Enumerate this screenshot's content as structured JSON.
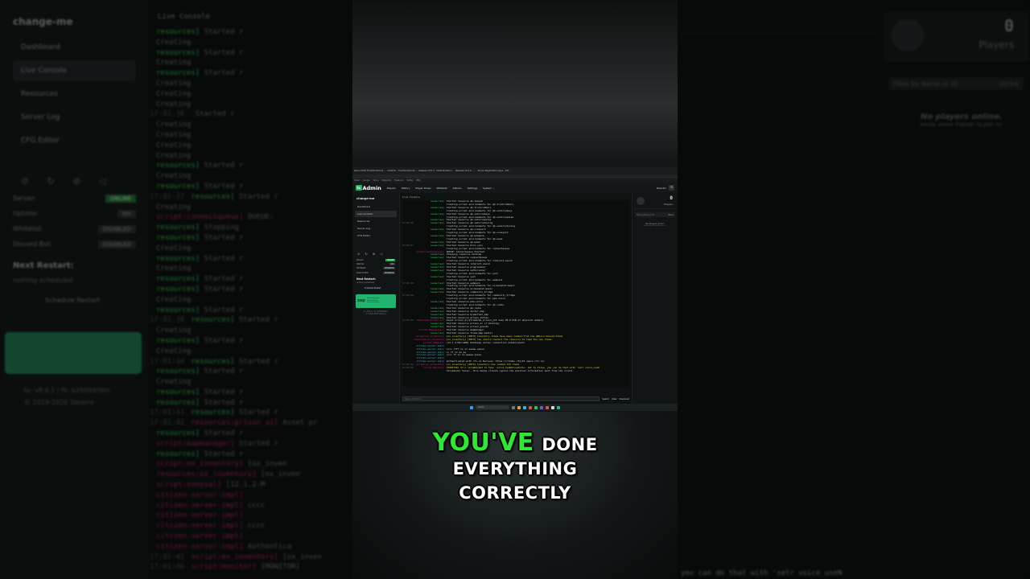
{
  "background": {
    "sidebar": {
      "brand": "change-me",
      "nav": [
        "Dashboard",
        "Live Console",
        "Resources",
        "Server Log",
        "CFG Editor"
      ],
      "status": [
        {
          "label": "Server:",
          "value": "ONLINE"
        },
        {
          "label": "Uptime:",
          "value": "0m"
        },
        {
          "label": "Whitelist:",
          "value": "DISABLED"
        },
        {
          "label": "Discord Bot:",
          "value": "DISABLED"
        }
      ],
      "restart_title": "Next Restart:",
      "restart_value": "nothing scheduled",
      "schedule_label": "Schedule Restart",
      "version_line1": "tx: v8.0.1 | fx: b25099/Win",
      "version_line2": "© 2019-2026 Tabarra"
    },
    "console_title": "Live Console",
    "console_lines": [
      {
        "time": "",
        "src": "resources]",
        "msg": "Started r"
      },
      {
        "time": "",
        "src": "",
        "msg": "Creating"
      },
      {
        "time": "",
        "src": "resources]",
        "msg": "Started r"
      },
      {
        "time": "",
        "src": "",
        "msg": "Creating"
      },
      {
        "time": "",
        "src": "resources]",
        "msg": "Started r"
      },
      {
        "time": "",
        "src": "",
        "msg": "Creating"
      },
      {
        "time": "",
        "src": "",
        "msg": "Creating"
      },
      {
        "time": "",
        "src": "",
        "msg": "Creating"
      },
      {
        "time": "17:01:36",
        "src": "",
        "msg": "Started r"
      },
      {
        "time": "",
        "src": "",
        "msg": "Creating"
      },
      {
        "time": "",
        "src": "",
        "msg": "Creating"
      },
      {
        "time": "",
        "src": "",
        "msg": "Creating"
      },
      {
        "time": "",
        "src": "",
        "msg": "Creating"
      },
      {
        "time": "",
        "src": "resources]",
        "msg": "Started r"
      },
      {
        "time": "",
        "src": "",
        "msg": "Creating"
      },
      {
        "time": "",
        "src": "resources]",
        "msg": "Started r"
      },
      {
        "time": "17:01:37",
        "src": "resources]",
        "msg": "Started r"
      },
      {
        "time": "",
        "src": "",
        "msg": "Creating"
      },
      {
        "time": "",
        "src": "script:connectqueue]",
        "msg": "QUEUE:"
      },
      {
        "time": "",
        "src": "resources]",
        "msg": "Stopping"
      },
      {
        "time": "",
        "src": "resources]",
        "msg": "Started r"
      },
      {
        "time": "",
        "src": "",
        "msg": "Creating"
      },
      {
        "time": "",
        "src": "resources]",
        "msg": "Started r"
      },
      {
        "time": "",
        "src": "",
        "msg": "Creating"
      },
      {
        "time": "",
        "src": "resources]",
        "msg": "Started r"
      },
      {
        "time": "",
        "src": "resources]",
        "msg": "Started r"
      },
      {
        "time": "",
        "src": "",
        "msg": "Creating"
      },
      {
        "time": "",
        "src": "resources]",
        "msg": "Started r"
      },
      {
        "time": "17:01:38",
        "src": "resources]",
        "msg": "Started r"
      },
      {
        "time": "",
        "src": "",
        "msg": "Creating"
      },
      {
        "time": "",
        "src": "resources]",
        "msg": "Started r"
      },
      {
        "time": "",
        "src": "",
        "msg": "Creating"
      },
      {
        "time": "17:01:40",
        "src": "resources]",
        "msg": "Started r"
      },
      {
        "time": "",
        "src": "resources]",
        "msg": "Started r"
      },
      {
        "time": "",
        "src": "",
        "msg": "Creating"
      },
      {
        "time": "",
        "src": "resources]",
        "msg": "Started r"
      },
      {
        "time": "",
        "src": "resources]",
        "msg": "Started r"
      },
      {
        "time": "17:01:41",
        "src": "resources]",
        "msg": "Started r"
      },
      {
        "time": "17:01:42",
        "src": "resources:prison_ai]",
        "msg": "Asset pr"
      },
      {
        "time": "",
        "src": "resources]",
        "msg": "Started r"
      },
      {
        "time": "",
        "src": "script:mapmanager]",
        "msg": "Started r"
      },
      {
        "time": "",
        "src": "resources]",
        "msg": "Started r"
      },
      {
        "time": "",
        "src": "script:ox_inventory]",
        "msg": "[ox_inven"
      },
      {
        "time": "",
        "src": "resources:ox_inventory]",
        "msg": "[ox_inven"
      },
      {
        "time": "",
        "src": "script:oxmysql]",
        "msg": "[12.1.2-M"
      },
      {
        "time": "",
        "src": "citizen-server-impl]",
        "msg": ""
      },
      {
        "time": "",
        "src": "citizen-server-impl]",
        "msg": "cccc"
      },
      {
        "time": "",
        "src": "citizen-server-impl]",
        "msg": ""
      },
      {
        "time": "",
        "src": "citizen-server-impl]",
        "msg": "cccc"
      },
      {
        "time": "",
        "src": "citizen-server-impl]",
        "msg": ""
      },
      {
        "time": "",
        "src": "citizen-server-impl]",
        "msg": "Authentica"
      },
      {
        "time": "17:01:42",
        "src": "script:ox_inventory]",
        "msg": "[ox_inven"
      },
      {
        "time": "17:01:46",
        "src": "script:monitor]",
        "msg": "[MONITOR]"
      }
    ],
    "players_count": "0",
    "players_label": "Players",
    "filter_placeholder": "Filter by Name or ID",
    "filter_shortcut": "ctrl+k",
    "no_players_title": "No players online.",
    "no_players_sub": "Invite some friends to join in!",
    "bottom_snippet": "you can do that with 'setr voice_useN"
  },
  "browser": {
    "tabs": [
      "Issue CSGO TheOnlineSocia...",
      "txAdmin - TheOnlineSocia...",
      "Release v0.0.3 - TheOnlineSoci...",
      "Release v2.0.0 - ...",
      "Server Registration Keys - Cfx..."
    ],
    "bookmarks": [
      "Gmail",
      "Google",
      "Yahoo",
      "Wikipedia",
      "Facebook",
      "Twitter",
      "BBC"
    ]
  },
  "app": {
    "logo_badge": "tx",
    "logo_text": "Admin",
    "menu": [
      "Players",
      "History",
      "Player Drops",
      "Whitelist",
      "Admins",
      "Settings",
      "System ⌄"
    ],
    "user": "Director",
    "sidebar": {
      "brand": "change-me",
      "nav": [
        "Dashboard",
        "Live Console",
        "Resources",
        "Server Log",
        "CFG Editor"
      ],
      "status": [
        {
          "label": "Server:",
          "value": "ONLINE"
        },
        {
          "label": "Uptime:",
          "value": "0m"
        },
        {
          "label": "Whitelist:",
          "value": "DISABLED"
        },
        {
          "label": "Discord Bot:",
          "value": "DISABLED"
        }
      ],
      "restart_title": "Next Restart:",
      "restart_value": "nothing scheduled",
      "schedule_label": "Schedule Restart",
      "ad_logo": "zap",
      "ad_line1": "Recommended",
      "ad_line2": "official FiveM",
      "ad_line3": "server provider",
      "version_line1": "tx: v8.0.1 | fx: b25099/Win",
      "version_line2": "© 2019-2026 Tabarra"
    },
    "console": {
      "title": "Live Console",
      "lines": [
        {
          "time": "",
          "src": "resources]",
          "msg": "Started resource qb-towjob"
        },
        {
          "time": "",
          "src": "",
          "msg": "Creating script environments for qb-truckrobbery"
        },
        {
          "time": "",
          "src": "resources]",
          "msg": "Started resource qb-truckrobbery"
        },
        {
          "time": "",
          "src": "",
          "msg": "Creating script environments for qb-vehiclekeys"
        },
        {
          "time": "",
          "src": "resources]",
          "msg": "Started resource qb-vehiclekeys"
        },
        {
          "time": "",
          "src": "",
          "msg": "Creating script environments for qb-vehiclesales"
        },
        {
          "time": "",
          "src": "resources]",
          "msg": "Started resource qb-vehiclesales"
        },
        {
          "time": "17:01:36",
          "src": "resources]",
          "msg": "Started resource qb-vehicletuning"
        },
        {
          "time": "",
          "src": "",
          "msg": "Creating script environments for qb-vehicletuning"
        },
        {
          "time": "",
          "src": "resources]",
          "msg": "Started resource qb-vineyard"
        },
        {
          "time": "",
          "src": "",
          "msg": "Creating script environments for qb-vineyard"
        },
        {
          "time": "",
          "src": "resources]",
          "msg": "Started resource qb-weapons"
        },
        {
          "time": "",
          "src": "",
          "msg": "Creating script environments for qb-weed"
        },
        {
          "time": "",
          "src": "resources]",
          "msg": "Started resource qb-weed"
        },
        {
          "time": "17:01:37",
          "src": "resources]",
          "msg": "Started resource bnrs-jail"
        },
        {
          "time": "",
          "src": "",
          "msg": "Creating script environments for connectqueue"
        },
        {
          "time": "",
          "src": "script:connectqueue]",
          "msg": "QUEUE: Connectqueue Started"
        },
        {
          "time": "",
          "src": "resources]",
          "msg": "Stopping resource hardcap"
        },
        {
          "time": "",
          "src": "resources]",
          "msg": "Started resource connectqueue"
        },
        {
          "time": "",
          "src": "",
          "msg": "Creating script environments for interact-sound"
        },
        {
          "time": "",
          "src": "resources]",
          "msg": "Started resource interact-sound"
        },
        {
          "time": "",
          "src": "resources]",
          "msg": "Started resource progressbar"
        },
        {
          "time": "",
          "src": "resources]",
          "msg": "Started resource safecracker"
        },
        {
          "time": "",
          "src": "",
          "msg": "Creating script environments for yarn"
        },
        {
          "time": "",
          "src": "resources]",
          "msg": "Started resource yarn"
        },
        {
          "time": "",
          "src": "",
          "msg": "Creating script environments for webpack"
        },
        {
          "time": "17:01:38",
          "src": "resources]",
          "msg": "Started resource webpack"
        },
        {
          "time": "",
          "src": "",
          "msg": "Creating script environments for screenshot-basic"
        },
        {
          "time": "",
          "src": "resources]",
          "msg": "Started resource screenshot-basic"
        },
        {
          "time": "",
          "src": "resources]",
          "msg": "Started resource community_bridge"
        },
        {
          "time": "17:01:40",
          "src": "",
          "msg": "Creating script environments for community_bridge"
        },
        {
          "time": "",
          "src": "",
          "msg": "Creating script environments for pma-voice"
        },
        {
          "time": "",
          "src": "resources]",
          "msg": "Started resource pma-voice"
        },
        {
          "time": "",
          "src": "",
          "msg": "Creating script environments for qb-radio"
        },
        {
          "time": "",
          "src": "resources]",
          "msg": "Started resource qb-radio"
        },
        {
          "time": "",
          "src": "resources]",
          "msg": "Started resource doctor_map"
        },
        {
          "time": "",
          "src": "resources]",
          "msg": "Started resource breakfast_map"
        },
        {
          "time": "",
          "src": "resources]",
          "msg": "Started resource prison_tattoo"
        },
        {
          "time": "17:01:41",
          "src": "resources:prison_ai]",
          "msg": "Asset prison_ai/stream/ap_prison_ytd uses 96.0 MiB of physical memory."
        },
        {
          "time": "",
          "src": "resources]",
          "msg": "Started resource prison_ai (1 warning)"
        },
        {
          "time": "",
          "src": "resources]",
          "msg": "Started resource prison_guards"
        },
        {
          "time": "",
          "src": "script:mapmanager]",
          "msg": "Started resource mapmanager"
        },
        {
          "time": "",
          "src": "resources]",
          "msg": "Started resource fivem-map-skater"
        },
        {
          "time": "",
          "src": "script:ox_inventory]",
          "msg": "[ox_inventory] [INFO] Inventory items have been loaded from the QBCore.Shared.Items"
        },
        {
          "time": "",
          "src": "resources:ox_inventory]",
          "msg": "[ox_inventory] [INFO] You should restart the resource to load the new items."
        },
        {
          "time": "",
          "src": "script:oxmysql]",
          "msg": "[12.1.2-MariaDB] Database server connection established!"
        },
        {
          "time": "",
          "src": "citizen-server-impl]",
          "msg": ""
        },
        {
          "time": "",
          "src": "citizen-server-impl]",
          "msg": "cccc  ffff  xx  xx  eeeee  sssss"
        },
        {
          "time": "",
          "src": "citizen-server-impl]",
          "msg": "cc    ff     xx    ee     ss"
        },
        {
          "time": "",
          "src": "citizen-server-impl]",
          "msg": "cccc  ff    xx  xx  eeeee  sssss"
        },
        {
          "time": "",
          "src": "citizen-server-impl]",
          "msg": ""
        },
        {
          "time": "",
          "src": "citizen-server-impl]",
          "msg": "Authenticated with cfx.re Nucleus: https://cfxdev-rfkjbf.users.cfx.re/"
        },
        {
          "time": "17:01:42",
          "src": "script:ox_inventory]",
          "msg": "[ox_inventory] [INFO] Inventory has loaded 312 items"
        },
        {
          "time": "17:01:46",
          "src": "script:monitor]",
          "msg": "[MONITOR] It's recommended to have 'voice_useNativeAudio' set to false, you can do that with 'setr voice_useN"
        },
        {
          "time": "",
          "src": "",
          "msg": "ativeAudio false', this means clients ignore the position information sent from the client."
        }
      ],
      "input_placeholder": "Type a command...",
      "buttons": [
        "Search",
        "Clear",
        "Download"
      ]
    },
    "players": {
      "count": "0",
      "label": "Players",
      "filter_placeholder": "Filter by Name or ID",
      "filter_shortcut": "ctrl+k",
      "none_title": "No players online.",
      "none_sub": "Invite some friends to join in!"
    }
  },
  "taskbar": {
    "search": "Search"
  },
  "caption": {
    "highlight": "YOU'VE",
    "rest1": "DONE",
    "line2": "EVERYTHING",
    "line3": "CORRECTLY"
  },
  "colors": {
    "caption_highlight": "#2bea31",
    "console_resource": "#33d05a",
    "console_script": "#c4287b",
    "online_badge": "#23a04b",
    "ad_background": "#22b46e"
  }
}
